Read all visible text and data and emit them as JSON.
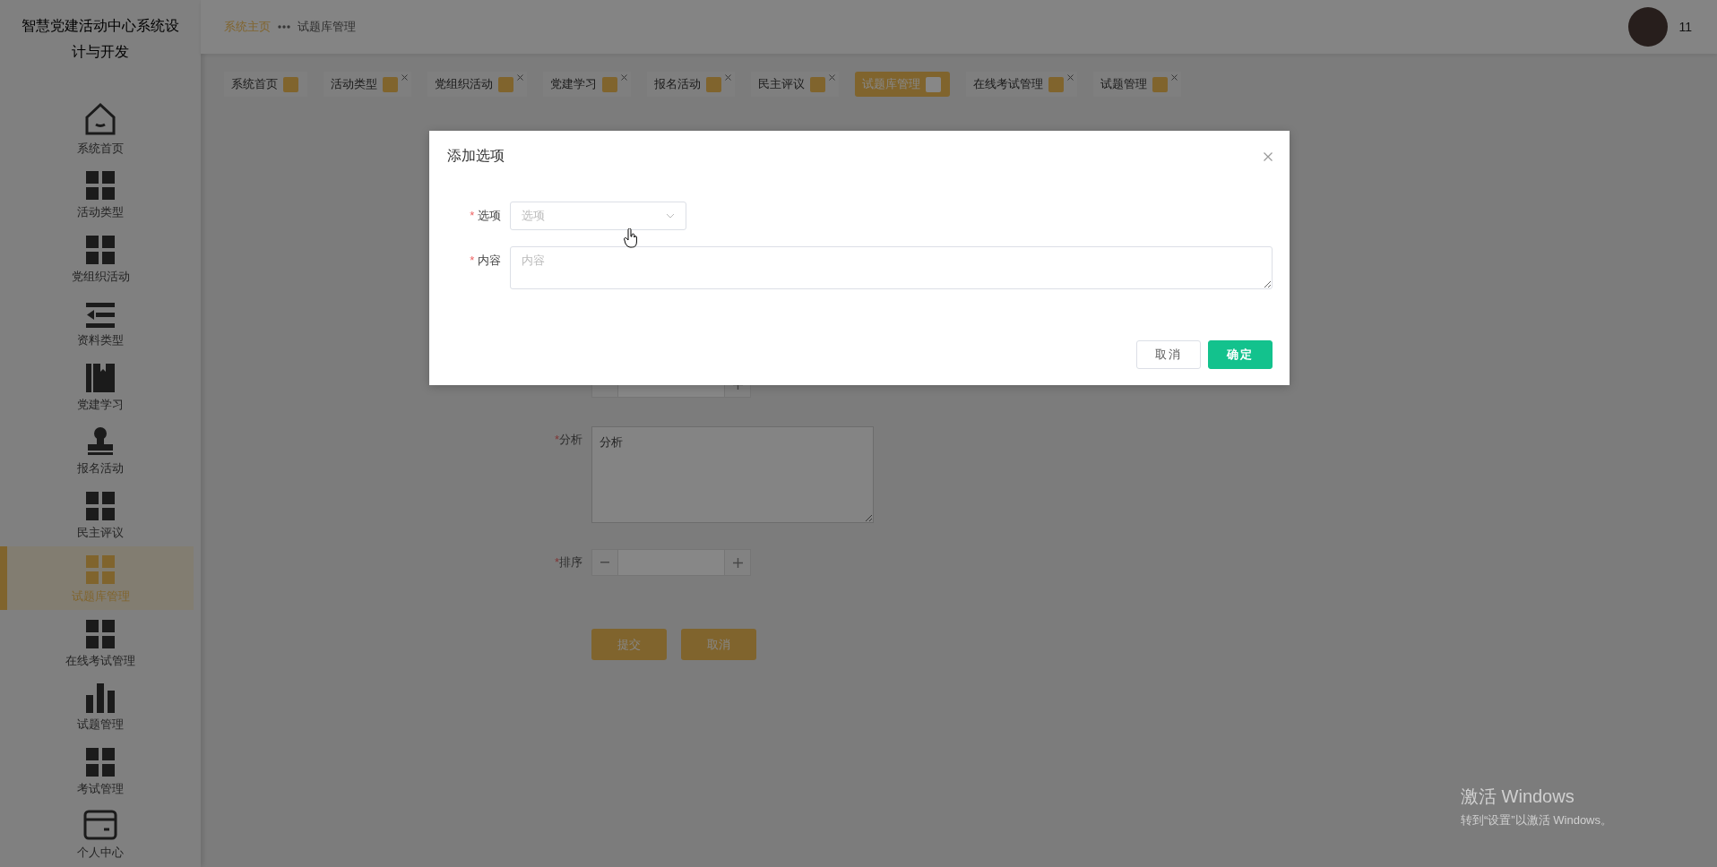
{
  "sidebar": {
    "title": "智慧党建活动中心系统设计与开发",
    "items": [
      {
        "label": "系统首页",
        "kind": "house",
        "selected": false
      },
      {
        "label": "活动类型",
        "kind": "grid",
        "selected": false
      },
      {
        "label": "党组织活动",
        "kind": "grid",
        "selected": false
      },
      {
        "label": "资料类型",
        "kind": "list",
        "selected": false
      },
      {
        "label": "党建学习",
        "kind": "book",
        "selected": false
      },
      {
        "label": "报名活动",
        "kind": "stamp",
        "selected": false
      },
      {
        "label": "民主评议",
        "kind": "grid",
        "selected": false
      },
      {
        "label": "试题库管理",
        "kind": "grid",
        "selected": true
      },
      {
        "label": "在线考试管理",
        "kind": "grid",
        "selected": false
      },
      {
        "label": "试题管理",
        "kind": "bars",
        "selected": false
      },
      {
        "label": "考试管理",
        "kind": "grid",
        "selected": false
      },
      {
        "label": "个人中心",
        "kind": "card",
        "selected": false
      }
    ]
  },
  "header": {
    "breadcrumb": [
      {
        "label": "系统主页",
        "kind": "link"
      },
      {
        "label": "试题库管理",
        "kind": "current"
      }
    ],
    "user": {
      "name": "11"
    }
  },
  "tabs": [
    {
      "label": "系统首页",
      "selected": false,
      "closable": false
    },
    {
      "label": "活动类型",
      "selected": false,
      "closable": true
    },
    {
      "label": "党组织活动",
      "selected": false,
      "closable": true
    },
    {
      "label": "党建学习",
      "selected": false,
      "closable": true
    },
    {
      "label": "报名活动",
      "selected": false,
      "closable": true
    },
    {
      "label": "民主评议",
      "selected": false,
      "closable": true
    },
    {
      "label": "试题库管理",
      "selected": true,
      "closable": false
    },
    {
      "label": "在线考试管理",
      "selected": false,
      "closable": true
    },
    {
      "label": "试题管理",
      "selected": false,
      "closable": true
    }
  ],
  "form": {
    "fields": [
      {
        "kind": "number"
      },
      {
        "label": "分析",
        "kind": "textarea",
        "required_mark": "*",
        "placeholder": "分析"
      },
      {
        "label": "排序",
        "kind": "number",
        "required_mark": "*"
      }
    ],
    "buttons": [
      {
        "label": "提交"
      },
      {
        "label": "取消"
      }
    ]
  },
  "dialog": {
    "title": "添加选项",
    "fields": [
      {
        "label": "选项",
        "required_mark": "*",
        "kind": "select",
        "placeholder": "选项"
      },
      {
        "label": "内容",
        "required_mark": "*",
        "kind": "textarea",
        "placeholder": "内容"
      }
    ],
    "buttons": [
      {
        "label": "取消",
        "kind": "default"
      },
      {
        "label": "确定",
        "kind": "primary"
      }
    ]
  },
  "windows_notice": {
    "title": "激活 Windows",
    "text": "转到“设置”以激活 Windows。"
  }
}
